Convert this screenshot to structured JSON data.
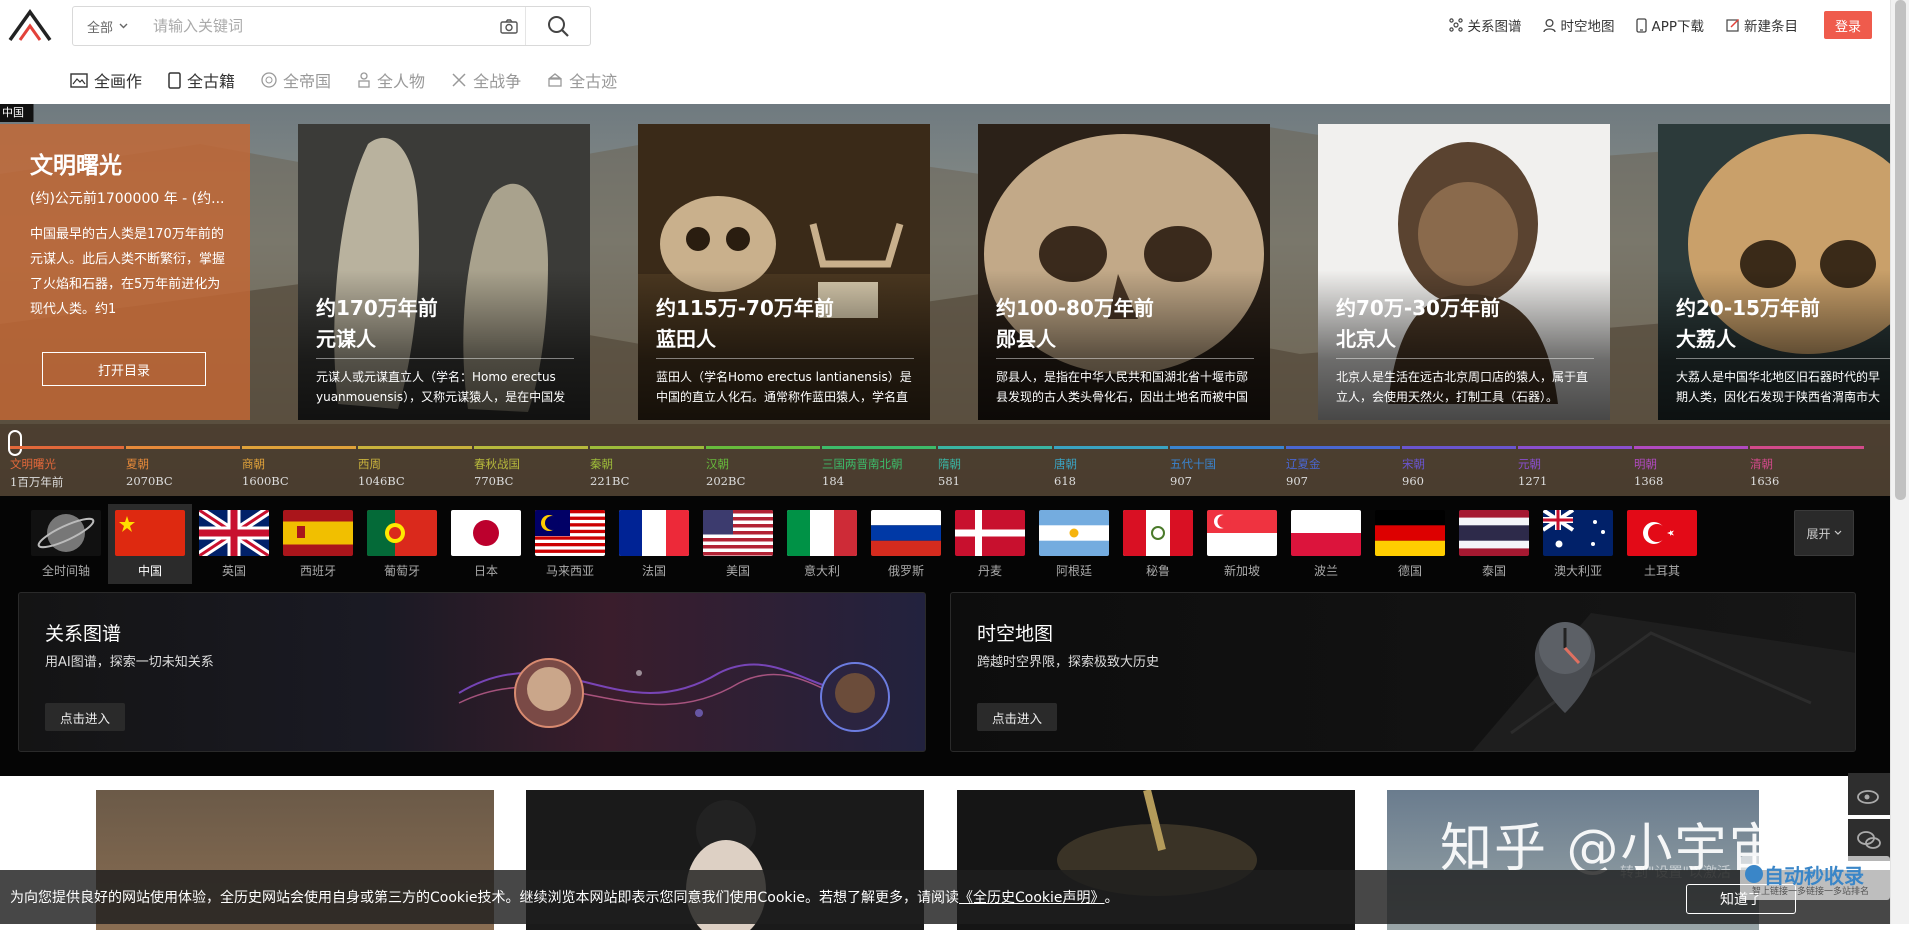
{
  "header": {
    "search_scope": "全部",
    "search_placeholder": "请输入关键词",
    "nav": [
      "关系图谱",
      "时空地图",
      "APP下载",
      "新建条目"
    ],
    "login": "登录"
  },
  "subnav": [
    {
      "label": "全画作",
      "state": "active"
    },
    {
      "label": "全古籍",
      "state": "active"
    },
    {
      "label": "全帝国",
      "state": "disabled"
    },
    {
      "label": "全人物",
      "state": "disabled"
    },
    {
      "label": "全战争",
      "state": "disabled"
    },
    {
      "label": "全古迹",
      "state": "disabled"
    }
  ],
  "hero": {
    "country_tag": "中国",
    "intro": {
      "title": "文明曙光",
      "date": "(约)公元前1700000 年 - (约...",
      "desc": "中国最早的古人类是170万年前的元谋人。此后人类不断繁衍，掌握了火焰和石器，在5万年前进化为现代人类。约1",
      "button": "打开目录"
    },
    "cards": [
      {
        "period": "约170万年前",
        "title": "元谋人",
        "desc": "元谋人或元谋直立人（学名：Homo erectus yuanmouensis），又称元谋猿人，是在中国发"
      },
      {
        "period": "约115万-70万年前",
        "title": "蓝田人",
        "desc": "蓝田人（学名Homo erectus lantianensis）是中国的直立人化石。通常称作蓝田猿人，学名直"
      },
      {
        "period": "约100-80万年前",
        "title": "郧县人",
        "desc": "郧县人，是指在中华人民共和国湖北省十堰市郧县发现的古人类头骨化石，因出土地名而被中国"
      },
      {
        "period": "约70万-30万年前",
        "title": "北京人",
        "desc": "北京人是生活在远古北京周口店的猿人，属于直立人，会使用天然火，打制工具（石器）。"
      },
      {
        "period": "约20-15万年前",
        "title": "大荔人",
        "desc": "大荔人是中国华北地区旧石器时代的早期人类，因化石发现于陕西省渭南市大荔县解放村"
      }
    ],
    "timeline": [
      {
        "label": "文明曙光",
        "year": "1百万年前",
        "color": "#e2683a"
      },
      {
        "label": "夏朝",
        "year": "2070BC",
        "color": "#e78a3a"
      },
      {
        "label": "商朝",
        "year": "1600BC",
        "color": "#e0a23a"
      },
      {
        "label": "西周",
        "year": "1046BC",
        "color": "#c9b23c"
      },
      {
        "label": "春秋战国",
        "year": "770BC",
        "color": "#b7b93c"
      },
      {
        "label": "秦朝",
        "year": "221BC",
        "color": "#9dbb3a"
      },
      {
        "label": "汉朝",
        "year": "202BC",
        "color": "#67bb3c"
      },
      {
        "label": "三国两晋南北朝",
        "year": "184",
        "color": "#3dbb6a"
      },
      {
        "label": "隋朝",
        "year": "581",
        "color": "#3ab5a3"
      },
      {
        "label": "唐朝",
        "year": "618",
        "color": "#3aa3c2"
      },
      {
        "label": "五代十国",
        "year": "907",
        "color": "#3a84d0"
      },
      {
        "label": "辽夏金",
        "year": "907",
        "color": "#4a67d2"
      },
      {
        "label": "宋朝",
        "year": "960",
        "color": "#6a55d0"
      },
      {
        "label": "元朝",
        "year": "1271",
        "color": "#8a4fcf"
      },
      {
        "label": "明朝",
        "year": "1368",
        "color": "#b04ac0"
      },
      {
        "label": "清朝",
        "year": "1636",
        "color": "#d24a8a"
      }
    ]
  },
  "countries": [
    "全时间轴",
    "中国",
    "英国",
    "西班牙",
    "葡萄牙",
    "日本",
    "马来西亚",
    "法国",
    "美国",
    "意大利",
    "俄罗斯",
    "丹麦",
    "阿根廷",
    "秘鲁",
    "新加坡",
    "波兰",
    "德国",
    "泰国",
    "澳大利亚",
    "土耳其"
  ],
  "active_country": "中国",
  "expand": "展开",
  "features": [
    {
      "title": "关系图谱",
      "sub": "用AI图谱，探索一切未知关系",
      "button": "点击进入"
    },
    {
      "title": "时空地图",
      "sub": "跨越时空界限，探索极致大历史",
      "button": "点击进入"
    }
  ],
  "cookie": {
    "text": "为向您提供良好的网站使用体验，全历史网站会使用自身或第三方的Cookie技术。继续浏览本网站即表示您同意我们使用Cookie。若想了解更多，请阅读",
    "link": "《全历史Cookie声明》",
    "end": "。",
    "button": "知道了"
  },
  "watermark": "知乎 @小宇宙网",
  "watermark_logo": "自动秒收录",
  "watermark_logo_sub": "智上链接一多链接一多站排名",
  "windows_hint": "转到\"设置\"以激活"
}
